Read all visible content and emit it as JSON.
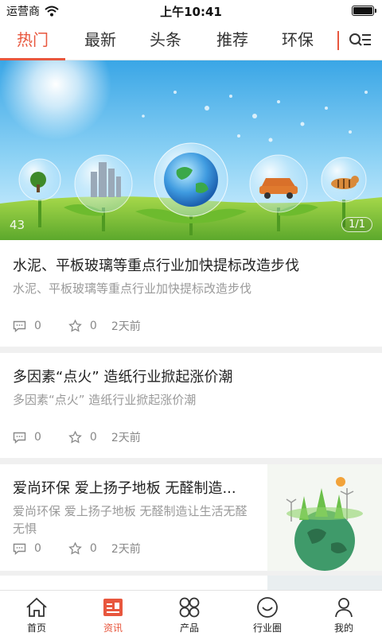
{
  "status_bar": {
    "carrier": "运营商",
    "time": "上午10:41",
    "battery_level": 1.0
  },
  "tabs": {
    "items": [
      "热门",
      "最新",
      "头条",
      "推荐",
      "环保"
    ],
    "active_index": 0,
    "menu_icon": "list-search-icon"
  },
  "hero": {
    "count": "43",
    "page": "1/1"
  },
  "articles": [
    {
      "title": "水泥、平板玻璃等重点行业加快提标改造步伐",
      "summary": "水泥、平板玻璃等重点行业加快提标改造步伐",
      "comments": "0",
      "likes": "0",
      "time": "2天前"
    },
    {
      "title": "多因素“点火” 造纸行业掀起涨价潮",
      "summary": "多因素“点火” 造纸行业掀起涨价潮",
      "comments": "0",
      "likes": "0",
      "time": "2天前"
    },
    {
      "title": "爱尚环保 爱上扬子地板 无醛制造...",
      "summary": "爱尚环保 爱上扬子地板 无醛制造让生活无醛无惧",
      "comments": "0",
      "likes": "0",
      "time": "2天前"
    }
  ],
  "bottom_nav": {
    "items": [
      {
        "label": "首页",
        "icon": "home-icon"
      },
      {
        "label": "资讯",
        "icon": "news-icon"
      },
      {
        "label": "产品",
        "icon": "products-icon"
      },
      {
        "label": "行业圈",
        "icon": "industry-circle-icon"
      },
      {
        "label": "我的",
        "icon": "profile-icon"
      }
    ],
    "active_index": 1
  },
  "colors": {
    "accent": "#e8573e",
    "muted_text": "#9a9a9a",
    "divider": "#f0f0f0"
  }
}
